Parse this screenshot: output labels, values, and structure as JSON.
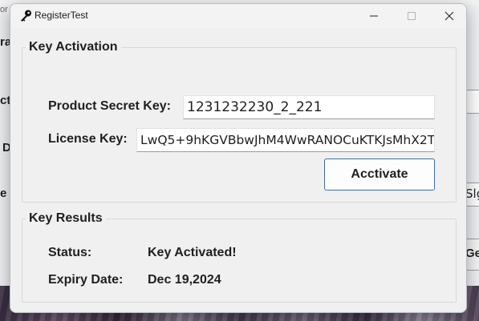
{
  "background": {
    "fragments": [
      "or",
      "ra",
      "ct",
      "D",
      "e",
      "Slg",
      "Ge"
    ]
  },
  "window": {
    "title": "RegisterTest",
    "icon": "key-icon"
  },
  "activation": {
    "group_title": "Key Activation",
    "secret_label": "Product Secret Key:",
    "secret_value": "1231232230_2_221",
    "license_label": "License Key:",
    "license_value": "LwQ5+9hKGVBbwJhM4WwRANOCuKTKJsMhX2T",
    "button_label": "Acctivate"
  },
  "results": {
    "group_title": "Key Results",
    "status_label": "Status:",
    "status_value": "Key Activated!",
    "expiry_label": "Expiry Date:",
    "expiry_value": "Dec 19,2024"
  }
}
